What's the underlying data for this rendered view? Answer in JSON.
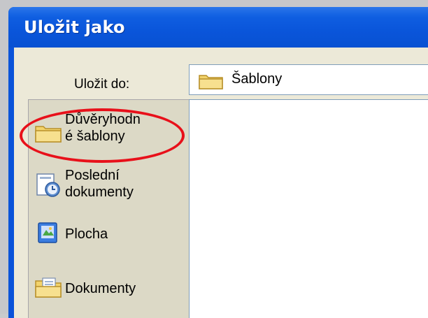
{
  "window": {
    "title": "Uložit jako"
  },
  "save_in": {
    "label": "Uložit do:",
    "value": "Šablony"
  },
  "places": [
    {
      "label": "Důvěryhodn\né šablony",
      "icon": "folder-icon"
    },
    {
      "label": "Poslední\ndokumenty",
      "icon": "recent-documents-icon"
    },
    {
      "label": "Plocha",
      "icon": "desktop-icon"
    },
    {
      "label": "Dokumenty",
      "icon": "my-documents-icon"
    }
  ],
  "colors": {
    "titlebar": "#0a55da",
    "highlight": "#e8101a",
    "client": "#ece9d8"
  }
}
